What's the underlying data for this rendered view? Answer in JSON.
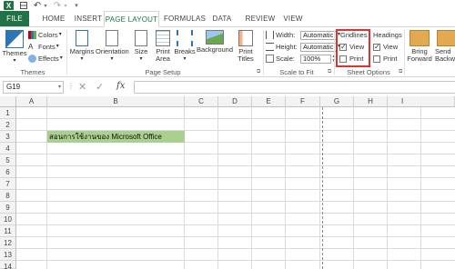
{
  "quick_access": {
    "logo_text": "X"
  },
  "tabs": [
    "FILE",
    "HOME",
    "INSERT",
    "PAGE LAYOUT",
    "FORMULAS",
    "DATA",
    "REVIEW",
    "VIEW"
  ],
  "ribbon": {
    "themes": {
      "themes_label": "Themes",
      "colors_label": "Colors",
      "fonts_label": "Fonts",
      "effects_label": "Effects",
      "group_label": "Themes"
    },
    "page_setup": {
      "margins_label": "Margins",
      "orientation_label": "Orientation",
      "size_label": "Size",
      "print_area_label": "Print Area",
      "breaks_label": "Breaks",
      "background_label": "Background",
      "print_titles_label": "Print Titles",
      "group_label": "Page Setup"
    },
    "scale_to_fit": {
      "width_label": "Width:",
      "width_value": "Automatic",
      "height_label": "Height:",
      "height_value": "Automatic",
      "scale_label": "Scale:",
      "scale_value": "100%",
      "group_label": "Scale to Fit"
    },
    "sheet_options": {
      "gridlines_label": "Gridlines",
      "gridlines_view_label": "View",
      "gridlines_view_checked": true,
      "gridlines_print_label": "Print",
      "gridlines_print_checked": false,
      "headings_label": "Headings",
      "headings_view_label": "View",
      "headings_view_checked": true,
      "headings_print_label": "Print",
      "headings_print_checked": false,
      "group_label": "Sheet Options"
    },
    "arrange": {
      "bring_forward_label": "Bring Forward",
      "send_backward_label": "Send Backw"
    }
  },
  "formula_bar": {
    "name_box": "G19",
    "cancel": "✕",
    "enter": "✓",
    "fx": "fx",
    "formula": ""
  },
  "columns": [
    "A",
    "B",
    "C",
    "D",
    "E",
    "F",
    "G",
    "H",
    "I"
  ],
  "rows": [
    "1",
    "2",
    "3",
    "4",
    "5",
    "6",
    "7",
    "8",
    "9",
    "10",
    "11",
    "12",
    "13",
    "14"
  ],
  "cells": {
    "B3": "สอนการใช้งานของ   Microsoft Office"
  },
  "colors": {
    "excel_green": "#217346",
    "cell_fill": "#a9d08e",
    "highlight_box": "#e03030"
  }
}
